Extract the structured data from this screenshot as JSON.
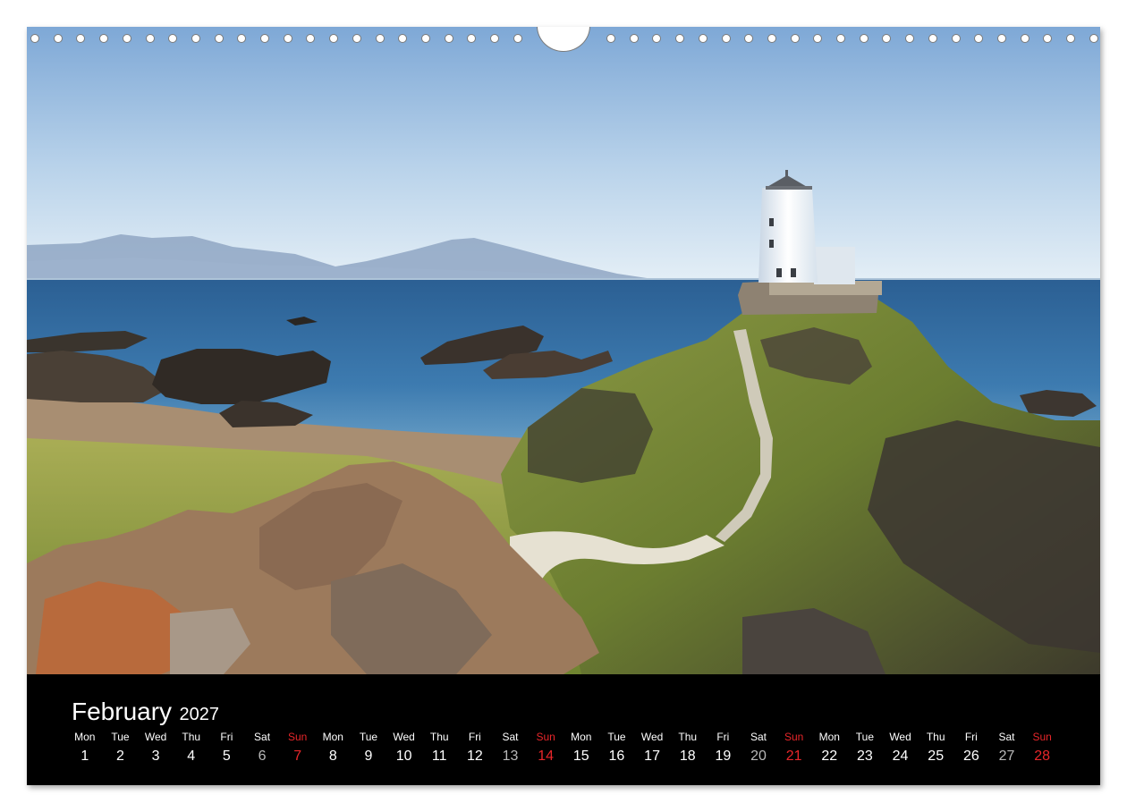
{
  "calendar": {
    "month": "February",
    "year": "2027",
    "days": [
      {
        "dow": "Mon",
        "num": "1",
        "type": "weekday"
      },
      {
        "dow": "Tue",
        "num": "2",
        "type": "weekday"
      },
      {
        "dow": "Wed",
        "num": "3",
        "type": "weekday"
      },
      {
        "dow": "Thu",
        "num": "4",
        "type": "weekday"
      },
      {
        "dow": "Fri",
        "num": "5",
        "type": "weekday"
      },
      {
        "dow": "Sat",
        "num": "6",
        "type": "sat"
      },
      {
        "dow": "Sun",
        "num": "7",
        "type": "sun"
      },
      {
        "dow": "Mon",
        "num": "8",
        "type": "weekday"
      },
      {
        "dow": "Tue",
        "num": "9",
        "type": "weekday"
      },
      {
        "dow": "Wed",
        "num": "10",
        "type": "weekday"
      },
      {
        "dow": "Thu",
        "num": "11",
        "type": "weekday"
      },
      {
        "dow": "Fri",
        "num": "12",
        "type": "weekday"
      },
      {
        "dow": "Sat",
        "num": "13",
        "type": "sat"
      },
      {
        "dow": "Sun",
        "num": "14",
        "type": "sun"
      },
      {
        "dow": "Mon",
        "num": "15",
        "type": "weekday"
      },
      {
        "dow": "Tue",
        "num": "16",
        "type": "weekday"
      },
      {
        "dow": "Wed",
        "num": "17",
        "type": "weekday"
      },
      {
        "dow": "Thu",
        "num": "18",
        "type": "weekday"
      },
      {
        "dow": "Fri",
        "num": "19",
        "type": "weekday"
      },
      {
        "dow": "Sat",
        "num": "20",
        "type": "sat"
      },
      {
        "dow": "Sun",
        "num": "21",
        "type": "sun"
      },
      {
        "dow": "Mon",
        "num": "22",
        "type": "weekday"
      },
      {
        "dow": "Tue",
        "num": "23",
        "type": "weekday"
      },
      {
        "dow": "Wed",
        "num": "24",
        "type": "weekday"
      },
      {
        "dow": "Thu",
        "num": "25",
        "type": "weekday"
      },
      {
        "dow": "Fri",
        "num": "26",
        "type": "weekday"
      },
      {
        "dow": "Sat",
        "num": "27",
        "type": "sat"
      },
      {
        "dow": "Sun",
        "num": "28",
        "type": "sun"
      }
    ]
  },
  "colors": {
    "sunday": "#e8262a",
    "saturday": "#b8b8b8",
    "weekday": "#ffffff",
    "background": "#000000"
  }
}
